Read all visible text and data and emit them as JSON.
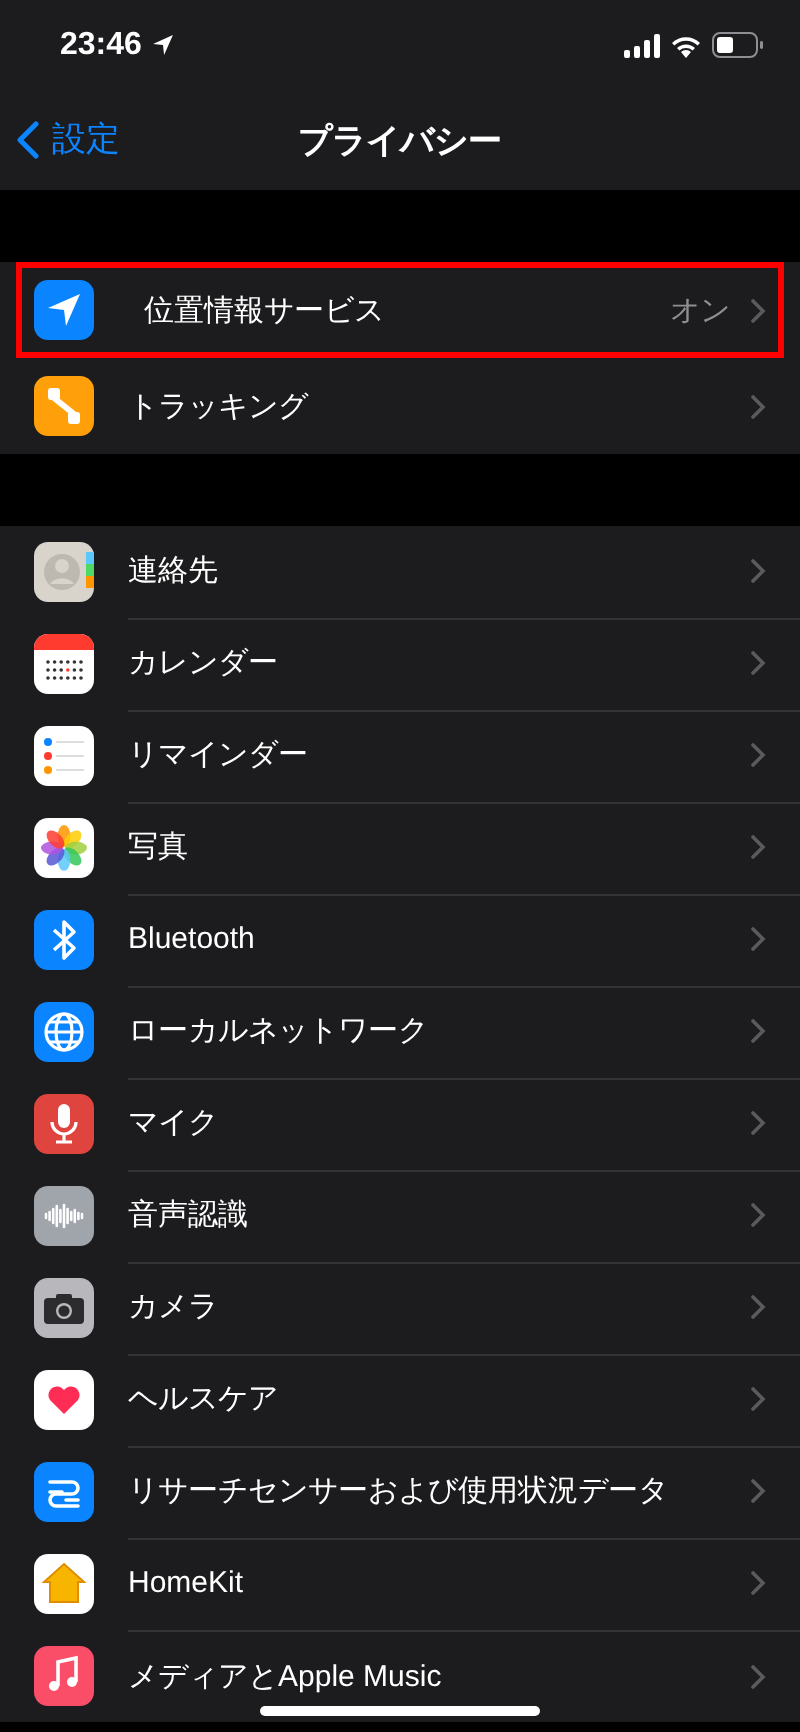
{
  "status_bar": {
    "time": "23:46"
  },
  "nav": {
    "back": "設定",
    "title": "プライバシー"
  },
  "groups": [
    {
      "items": [
        {
          "label": "位置情報サービス",
          "value": "オン",
          "highlighted": true
        },
        {
          "label": "トラッキング",
          "highlighted": false
        }
      ]
    },
    {
      "items": [
        {
          "label": "連絡先",
          "highlighted": false
        },
        {
          "label": "カレンダー",
          "highlighted": false
        },
        {
          "label": "リマインダー",
          "highlighted": false
        },
        {
          "label": "写真",
          "highlighted": false
        },
        {
          "label": "Bluetooth",
          "highlighted": false
        },
        {
          "label": "ローカルネットワーク",
          "highlighted": false
        },
        {
          "label": "マイク",
          "highlighted": false
        },
        {
          "label": "音声認識",
          "highlighted": false
        },
        {
          "label": "カメラ",
          "highlighted": false
        },
        {
          "label": "ヘルスケア",
          "highlighted": false
        },
        {
          "label": "リサーチセンサーおよび使用状況データ",
          "highlighted": false
        },
        {
          "label": "HomeKit",
          "highlighted": false
        },
        {
          "label": "メディアとApple Music",
          "highlighted": false
        }
      ]
    }
  ]
}
